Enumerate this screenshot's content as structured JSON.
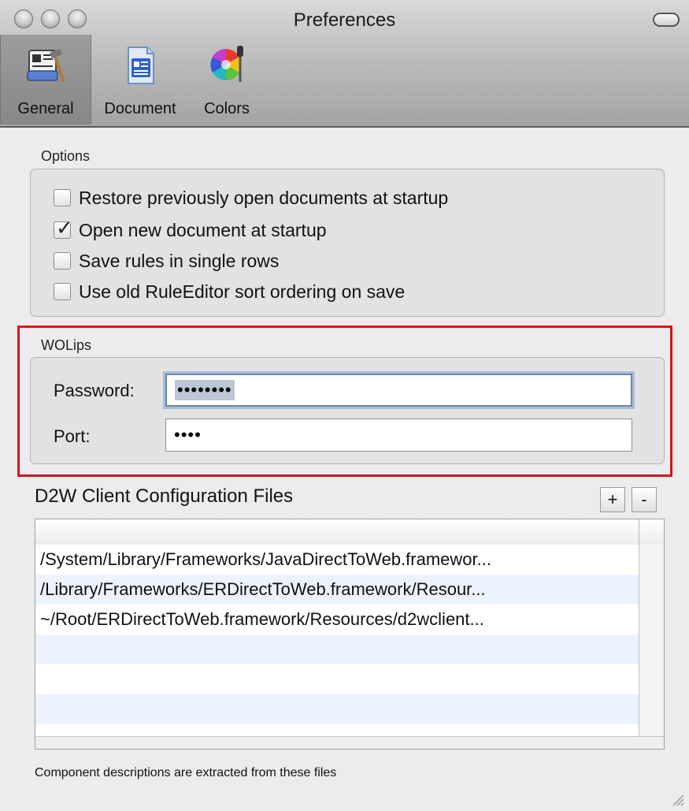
{
  "window": {
    "title": "Preferences"
  },
  "toolbar": {
    "items": [
      {
        "label": "General",
        "icon": "general-prefs-icon",
        "selected": true
      },
      {
        "label": "Document",
        "icon": "document-icon",
        "selected": false
      },
      {
        "label": "Colors",
        "icon": "color-wheel-icon",
        "selected": false
      }
    ]
  },
  "options": {
    "heading": "Options",
    "checkboxes": [
      {
        "label": "Restore previously open documents at startup",
        "checked": false
      },
      {
        "label": "Open new document at startup",
        "checked": true
      },
      {
        "label": "Save rules in single rows",
        "checked": false
      },
      {
        "label": "Use old RuleEditor sort ordering on save",
        "checked": false
      }
    ]
  },
  "wolips": {
    "heading": "WOLips",
    "password_label": "Password:",
    "password_value": "••••••••",
    "port_label": "Port:",
    "port_value": "••••"
  },
  "d2w": {
    "heading": "D2W Client Configuration Files",
    "add_label": "+",
    "remove_label": "-",
    "files": [
      "/System/Library/Frameworks/JavaDirectToWeb.framewor...",
      "/Library/Frameworks/ERDirectToWeb.framework/Resour...",
      "~/Root/ERDirectToWeb.framework/Resources/d2wclient..."
    ],
    "footnote": "Component descriptions are extracted from these files"
  },
  "colors": {
    "highlight_border": "#d7141b",
    "focus_ring": "#a8bfd9",
    "row_stripe": "#edf3fe"
  }
}
